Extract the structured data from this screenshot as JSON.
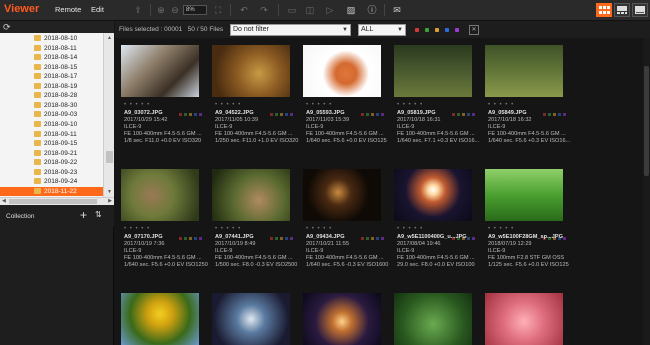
{
  "app": {
    "title": "Viewer",
    "menu": [
      "Remote",
      "Edit"
    ]
  },
  "toolbar": {
    "zoom": "8%",
    "icons": [
      "import-icon",
      "zoom-in-icon",
      "zoom-out-icon",
      "fit-icon",
      "rotate-left-icon",
      "rotate-right-icon",
      "flip-icon",
      "compare-icon",
      "play-icon",
      "image-icon",
      "info-icon",
      "mail-icon"
    ],
    "view_modes": [
      "grid-view",
      "single-view",
      "list-view"
    ]
  },
  "left": {
    "folders": [
      "2018-08-10",
      "2018-08-11",
      "2018-08-14",
      "2018-08-15",
      "2018-08-17",
      "2018-08-19",
      "2018-08-28",
      "2018-08-30",
      "2018-09-03",
      "2018-09-10",
      "2018-09-11",
      "2018-09-15",
      "2018-09-21",
      "2018-09-22",
      "2018-09-23",
      "2018-09-24",
      "2018-11-22"
    ],
    "selected_folder": "2018-11-22",
    "collection_label": "Collection"
  },
  "filter": {
    "files_selected": "Files selected : 00001",
    "count": "50 / 50 Files",
    "filter_value": "Do not filter",
    "rating_value": "ALL",
    "label_colors": [
      "#d23a3a",
      "#3aa33a",
      "#d9a12b",
      "#2b6cd9",
      "#9b3ad9"
    ]
  },
  "photos": [
    {
      "name": "A9_03072.JPG",
      "date": "2017/10/29 15:42",
      "camera": "ILCE-9",
      "lens": "FE 100-400mm F4.5-5.6 GM ...",
      "exposure": "1/8 sec. F11.0 +0.0 EV ISO320",
      "bg": "linear-gradient(135deg,#dfe8f0 0%,#8a7a66 40%,#3b3025 70%,#c9d3dd 100%)"
    },
    {
      "name": "A9_04522.JPG",
      "date": "2017/11/05 10:39",
      "camera": "ILCE-9",
      "lens": "FE 100-400mm F4.5-5.6 GM ...",
      "exposure": "1/250 sec. F11.0 +1.0 EV ISO320",
      "bg": "radial-gradient(circle at 60% 55%,#c79a45 0%,#8a5a22 40%,#4a2c10 80%)"
    },
    {
      "name": "A9_05593.JPG",
      "date": "2017/11/03 15:39",
      "camera": "ILCE-9",
      "lens": "FE 100-400mm F4.5-5.6 GM ...",
      "exposure": "1/640 sec. F5.6 +0.0 EV ISO125",
      "bg": "radial-gradient(circle at 55% 55%,#e0763a 0%,#d56a30 20%,#ffffff 45%,#f6f6f6 100%)"
    },
    {
      "name": "A9_05819.JPG",
      "date": "2017/10/18 16:31",
      "camera": "ILCE-9",
      "lens": "FE 100-400mm F4.5-5.6 GM ...",
      "exposure": "1/640 sec. F7.1 +0.3 EV ISO16...",
      "bg": "linear-gradient(180deg,#2a3a1f 0%,#4a5a2f 50%,#6b7a3a 100%)"
    },
    {
      "name": "A9_05849.JPG",
      "date": "2017/10/18 16:32",
      "camera": "ILCE-9",
      "lens": "FE 100-400mm F4.5-5.6 GM ...",
      "exposure": "1/640 sec. F5.6 +0.3 EV ISO16...",
      "bg": "linear-gradient(180deg,#3f5228 0%,#5e7236 45%,#8a9a4a 100%)"
    },
    {
      "name": "A9_07170.JPG",
      "date": "2017/10/19 7:36",
      "camera": "ILCE-9",
      "lens": "FE 100-400mm F4.5-5.6 GM ...",
      "exposure": "1/640 sec. F5.6 +0.0 EV ISO1250",
      "bg": "radial-gradient(circle at 40% 50%,#9a7a55 0%,#6e7a3a 40%,#2f3a1a 90%)"
    },
    {
      "name": "A9_07441.JPG",
      "date": "2017/10/19 8:49",
      "camera": "ILCE-9",
      "lens": "FE 100-400mm F4.5-5.6 GM ...",
      "exposure": "1/500 sec. F8.0 -0.3 EV ISO2500",
      "bg": "radial-gradient(circle at 60% 60%,#b08a60 0%,#5a6a30 45%,#1f2a10 90%)"
    },
    {
      "name": "A9_09434.JPG",
      "date": "2017/10/21 11:55",
      "camera": "ILCE-9",
      "lens": "FE 100-400mm F4.5-5.6 GM ...",
      "exposure": "1/640 sec. F5.6 -0.3 EV ISO1600",
      "bg": "radial-gradient(circle at 45% 45%,#c98a40 0%,#4a2a12 25%,#0f0a05 60%)"
    },
    {
      "name": "A9_w5E1100400G_u...JPG",
      "date": "2017/08/04 19:46",
      "camera": "ILCE-9",
      "lens": "FE 100-400mm F4.5-5.6 GM ...",
      "exposure": "29.0 sec. F8.0 +0.0 EV ISO100",
      "bg": "radial-gradient(circle at 50% 40%,#ffffff 0%,#ffd9a0 10%,#c05a30 25%,#1a1430 55%,#0a0a18 100%)"
    },
    {
      "name": "A9_w5E100F28GM_sp...JPG",
      "date": "2018/07/19 12:29",
      "camera": "ILCE-9",
      "lens": "FE 100mm F2.8 STF GM OSS",
      "exposure": "1/125 sec. F5.6 +0.0 EV ISO125",
      "bg": "linear-gradient(180deg,#8fcf6a 0%,#4aa030 50%,#2a6a1a 100%)"
    },
    {
      "name": "",
      "date": "",
      "camera": "",
      "lens": "",
      "exposure": "",
      "bg": "radial-gradient(circle at 50% 40%,#f2d020 0%,#d0a010 25%,#3a6a1a 60%,#6a9ad0 100%)"
    },
    {
      "name": "",
      "date": "",
      "camera": "",
      "lens": "",
      "exposure": "",
      "bg": "radial-gradient(circle at 50% 50%,#e0e8f0 0%,#5a7aa0 30%,#1a1a30 80%)"
    },
    {
      "name": "",
      "date": "",
      "camera": "",
      "lens": "",
      "exposure": "",
      "bg": "radial-gradient(circle at 50% 55%,#ffd28a 0%,#c07030 20%,#2a1a40 55%,#0a0818 100%)"
    },
    {
      "name": "",
      "date": "",
      "camera": "",
      "lens": "",
      "exposure": "",
      "bg": "radial-gradient(circle at 50% 60%,#6aaa50 0%,#2a5a20 60%,#153010 100%)"
    },
    {
      "name": "",
      "date": "",
      "camera": "",
      "lens": "",
      "exposure": "",
      "bg": "radial-gradient(circle at 50% 55%,#ffb0b8 0%,#e07080 40%,#a03040 100%)"
    }
  ]
}
